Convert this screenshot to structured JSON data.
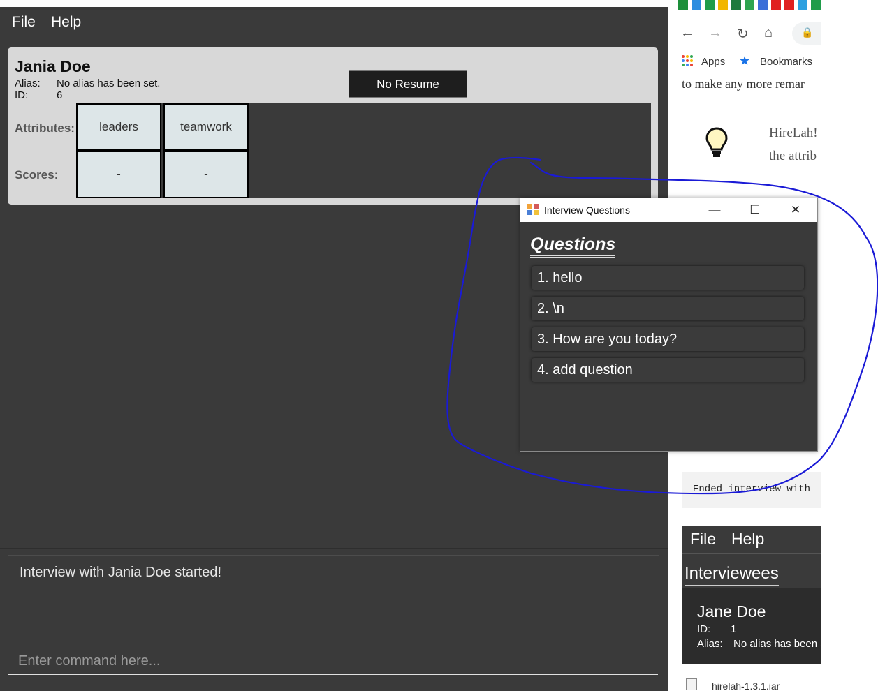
{
  "menubar": {
    "file": "File",
    "help": "Help"
  },
  "candidate": {
    "name": "Jania Doe",
    "alias_label": "Alias:",
    "alias_value": "No alias has been set.",
    "id_label": "ID:",
    "id_value": "6",
    "resume_button": "No Resume",
    "attributes_label": "Attributes:",
    "scores_label": "Scores:",
    "attributes": [
      "leaders",
      "teamwork"
    ],
    "scores": [
      "-",
      "-"
    ]
  },
  "result": {
    "message": "Interview with Jania Doe started!"
  },
  "command": {
    "placeholder": "Enter command here..."
  },
  "dialog": {
    "title": "Interview Questions",
    "heading": "Questions",
    "questions": [
      "1. hello",
      "2. \\n",
      "3. How are you today?",
      "4. add question"
    ]
  },
  "browser": {
    "apps_label": "Apps",
    "bookmarks_label": "Bookmarks",
    "text_line1": "to make any more remar",
    "tip_line1": "HireLah!",
    "tip_line2": "the attrib",
    "code_text": "Ended interview with",
    "mini_app": {
      "file": "File",
      "help": "Help",
      "title": "Interviewees",
      "name": "Jane Doe",
      "id_label": "ID:",
      "id_value": "1",
      "alias_label": "Alias:",
      "alias_value": "No alias has been s"
    },
    "download": "hirelah-1.3.1.jar"
  },
  "colors": {
    "annotation": "#1a1ad6",
    "app_bg": "#3a3a3a",
    "card_bg": "#d8d8d8"
  },
  "icons": [
    "lightbulb-icon",
    "back-icon",
    "forward-icon",
    "reload-icon",
    "home-icon",
    "lock-icon",
    "apps-grid-icon",
    "star-icon",
    "app-icon",
    "minimize-icon",
    "maximize-icon",
    "close-icon",
    "jar-file-icon"
  ]
}
